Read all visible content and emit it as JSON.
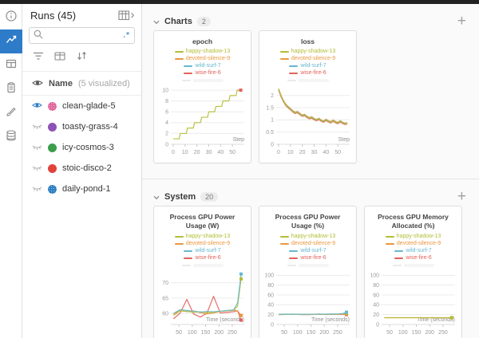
{
  "ui": {
    "plus": "+",
    "regex": ".*"
  },
  "sidebar": {
    "items": [
      {
        "id": "info",
        "active": false
      },
      {
        "id": "charts",
        "active": true
      },
      {
        "id": "panels",
        "active": false
      },
      {
        "id": "reports",
        "active": false
      },
      {
        "id": "sweeps",
        "active": false
      },
      {
        "id": "artifacts",
        "active": false
      }
    ]
  },
  "runs_panel": {
    "title": "Runs (45)",
    "search": {
      "value": "",
      "placeholder": ""
    },
    "name_header": "Name",
    "visualized_note": "(5 visualized)",
    "runs": [
      {
        "name": "clean-glade-5",
        "color": "#e0699f",
        "visible": true,
        "textured": true
      },
      {
        "name": "toasty-grass-4",
        "color": "#8d52b5",
        "visible": false,
        "textured": false
      },
      {
        "name": "icy-cosmos-3",
        "color": "#3a9e4c",
        "visible": false,
        "textured": false
      },
      {
        "name": "stoic-disco-2",
        "color": "#e0433c",
        "visible": false,
        "textured": false
      },
      {
        "name": "daily-pond-1",
        "color": "#2f80c2",
        "visible": false,
        "textured": true
      }
    ]
  },
  "sections": [
    {
      "label": "Charts",
      "count": "2"
    },
    {
      "label": "System",
      "count": "20"
    }
  ],
  "legend_runs": [
    {
      "name": "happy-shadow-13",
      "color": "#b3bd33"
    },
    {
      "name": "devoted-silence-9",
      "color": "#e9973e"
    },
    {
      "name": "wild-surf-7",
      "color": "#67b7cf"
    },
    {
      "name": "wise-fire-6",
      "color": "#e2625c"
    }
  ],
  "chart_data": [
    {
      "type": "line",
      "title": "epoch",
      "xlabel": "Step",
      "xlim": [
        -2,
        60
      ],
      "ylim": [
        0,
        10.6
      ],
      "xticks": [
        0,
        10,
        20,
        30,
        40,
        50
      ],
      "yticks": [
        0,
        2,
        4,
        6,
        8,
        10
      ],
      "legend_position": "top",
      "grid": true,
      "series": [
        {
          "name": "wise-fire-6",
          "color": "#e2625c",
          "marker": true,
          "x": [
            54,
            57
          ],
          "y": [
            10,
            10
          ]
        },
        {
          "name": "happy-shadow-13",
          "color": "#b3bd33",
          "marker": false,
          "x": [
            0,
            5,
            6,
            11,
            12,
            17,
            18,
            23,
            24,
            29,
            30,
            35,
            36,
            41,
            42,
            47,
            48,
            53,
            54,
            57
          ],
          "y": [
            1,
            1,
            2,
            2,
            3,
            3,
            4,
            4,
            5,
            5,
            6,
            6,
            7,
            7,
            8,
            8,
            9,
            9,
            10,
            10
          ]
        }
      ]
    },
    {
      "type": "line",
      "title": "loss",
      "xlabel": "Step",
      "xlim": [
        -2,
        60
      ],
      "ylim": [
        0,
        2.35
      ],
      "xticks": [
        0,
        10,
        20,
        30,
        40,
        50
      ],
      "yticks": [
        0,
        0.5,
        1,
        1.5,
        2
      ],
      "legend_position": "top",
      "grid": true,
      "x": [
        0,
        2,
        4,
        6,
        8,
        10,
        12,
        14,
        16,
        18,
        20,
        22,
        24,
        26,
        28,
        30,
        32,
        34,
        36,
        38,
        40,
        42,
        44,
        46,
        48,
        50,
        52,
        54,
        56,
        58
      ],
      "series": [
        {
          "name": "devoted-silence-9",
          "color": "#e9973e",
          "marker": false,
          "y": [
            2.28,
            2.01,
            1.81,
            1.65,
            1.55,
            1.47,
            1.38,
            1.32,
            1.35,
            1.27,
            1.2,
            1.23,
            1.15,
            1.1,
            1.13,
            1.06,
            1.02,
            1.07,
            1.0,
            0.96,
            1.03,
            0.97,
            0.93,
            1.0,
            0.94,
            0.9,
            0.97,
            0.91,
            0.87,
            0.89
          ]
        },
        {
          "name": "wild-surf-7",
          "color": "#67b7cf",
          "marker": false,
          "y": [
            2.26,
            1.99,
            1.79,
            1.63,
            1.53,
            1.45,
            1.36,
            1.3,
            1.33,
            1.25,
            1.18,
            1.21,
            1.13,
            1.08,
            1.11,
            1.04,
            1.0,
            1.05,
            0.98,
            0.94,
            1.01,
            0.95,
            0.91,
            0.98,
            0.92,
            0.88,
            0.95,
            0.89,
            0.85,
            0.87
          ]
        },
        {
          "name": "wise-fire-6",
          "color": "#e2625c",
          "marker": false,
          "y": [
            2.22,
            1.95,
            1.75,
            1.59,
            1.49,
            1.41,
            1.32,
            1.26,
            1.29,
            1.21,
            1.14,
            1.17,
            1.09,
            1.04,
            1.07,
            1.0,
            0.96,
            1.01,
            0.94,
            0.9,
            0.97,
            0.91,
            0.87,
            0.94,
            0.88,
            0.84,
            0.91,
            0.85,
            0.81,
            0.83
          ]
        },
        {
          "name": "happy-shadow-13",
          "color": "#b3bd33",
          "marker": false,
          "y": [
            2.25,
            1.98,
            1.78,
            1.62,
            1.52,
            1.44,
            1.35,
            1.29,
            1.32,
            1.24,
            1.17,
            1.2,
            1.12,
            1.07,
            1.1,
            1.03,
            0.99,
            1.04,
            0.97,
            0.93,
            1.0,
            0.94,
            0.9,
            0.97,
            0.91,
            0.87,
            0.94,
            0.88,
            0.84,
            0.86
          ]
        }
      ]
    },
    {
      "type": "line",
      "title": "Process GPU Power Usage (W)",
      "xlabel": "Time (seconds)",
      "xlim": [
        20,
        295
      ],
      "ylim": [
        56.5,
        73.5
      ],
      "xticks": [
        50,
        100,
        150,
        200,
        250
      ],
      "yticks": [
        60,
        65,
        70
      ],
      "legend_position": "top",
      "grid": true,
      "x": [
        30,
        55,
        80,
        105,
        130,
        155,
        180,
        205,
        230,
        255,
        270,
        283
      ],
      "series": [
        {
          "name": "wise-fire-6",
          "color": "#e2625c",
          "marker": true,
          "y": [
            58.3,
            60.2,
            64.6,
            59.9,
            58.9,
            60.1,
            65.6,
            60.2,
            60.4,
            60.6,
            60.9,
            57.9
          ]
        },
        {
          "name": "devoted-silence-9",
          "color": "#e9973e",
          "marker": true,
          "y": [
            59.8,
            61.0,
            60.6,
            60.9,
            60.3,
            59.9,
            60.2,
            60.7,
            61.0,
            61.1,
            60.9,
            59.4
          ]
        },
        {
          "name": "happy-shadow-13",
          "color": "#b3bd33",
          "marker": true,
          "y": [
            59.4,
            60.9,
            60.7,
            60.4,
            60.6,
            60.3,
            60.5,
            60.7,
            60.9,
            61.0,
            62.5,
            71.2
          ]
        },
        {
          "name": "wild-surf-7",
          "color": "#67b7cf",
          "marker": true,
          "y": [
            60.1,
            61.3,
            61.0,
            60.8,
            60.5,
            60.7,
            60.6,
            60.8,
            61.0,
            61.2,
            63.5,
            72.8
          ]
        }
      ]
    },
    {
      "type": "line",
      "title": "Process GPU Power Usage (%)",
      "xlabel": "Time (seconds)",
      "xlim": [
        20,
        295
      ],
      "ylim": [
        0,
        107
      ],
      "xticks": [
        50,
        100,
        150,
        200,
        250
      ],
      "yticks": [
        0,
        20,
        40,
        60,
        80,
        100
      ],
      "legend_position": "top",
      "grid": true,
      "x": [
        30,
        55,
        80,
        105,
        130,
        155,
        180,
        205,
        230,
        255,
        270,
        283
      ],
      "series": [
        {
          "name": "wise-fire-6",
          "color": "#e2625c",
          "marker": true,
          "y": [
            20.0,
            20.4,
            21.2,
            20.3,
            20.1,
            20.2,
            21.4,
            20.3,
            20.4,
            20.6,
            20.7,
            20.0
          ]
        },
        {
          "name": "devoted-silence-9",
          "color": "#e9973e",
          "marker": true,
          "y": [
            20.3,
            20.6,
            20.4,
            20.6,
            20.3,
            20.4,
            20.5,
            20.6,
            20.8,
            21.0,
            21.2,
            21.6
          ]
        },
        {
          "name": "happy-shadow-13",
          "color": "#b3bd33",
          "marker": true,
          "y": [
            20.6,
            20.9,
            20.7,
            20.8,
            20.6,
            20.7,
            20.8,
            20.9,
            21.1,
            21.3,
            21.8,
            23.0
          ]
        },
        {
          "name": "wild-surf-7",
          "color": "#67b7cf",
          "marker": true,
          "y": [
            20.8,
            21.1,
            20.9,
            21.0,
            20.8,
            20.9,
            21.0,
            21.1,
            21.3,
            21.6,
            22.3,
            25.0
          ]
        }
      ]
    },
    {
      "type": "line",
      "title": "Process GPU Memory Allocated (%)",
      "xlabel": "Time (seconds)",
      "xlim": [
        20,
        295
      ],
      "ylim": [
        0,
        107
      ],
      "xticks": [
        50,
        100,
        150,
        200,
        250
      ],
      "yticks": [
        0,
        20,
        40,
        60,
        80,
        100
      ],
      "legend_position": "top",
      "grid": true,
      "x": [
        30,
        283
      ],
      "series": [
        {
          "name": "devoted-silence-9",
          "color": "#e9973e",
          "marker": true,
          "y": [
            13.5,
            13.5
          ]
        },
        {
          "name": "happy-shadow-13",
          "color": "#b3bd33",
          "marker": true,
          "y": [
            13.9,
            13.9
          ]
        }
      ]
    }
  ]
}
